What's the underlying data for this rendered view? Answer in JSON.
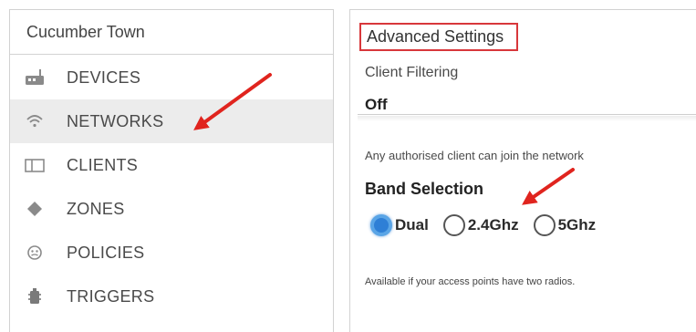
{
  "site": {
    "name": "Cucumber Town"
  },
  "nav": {
    "items": [
      {
        "label": "DEVICES",
        "icon": "device-icon"
      },
      {
        "label": "NETWORKS",
        "icon": "wifi-icon"
      },
      {
        "label": "CLIENTS",
        "icon": "clients-icon"
      },
      {
        "label": "ZONES",
        "icon": "zones-diamond-icon"
      },
      {
        "label": "POLICIES",
        "icon": "policies-icon"
      },
      {
        "label": "TRIGGERS",
        "icon": "triggers-icon"
      }
    ],
    "active": "NETWORKS"
  },
  "panel": {
    "title": "Advanced Settings",
    "client_filtering": {
      "label": "Client Filtering",
      "value": "Off",
      "description": "Any authorised client can join the network"
    },
    "band_selection": {
      "label": "Band Selection",
      "options": [
        "Dual",
        "2.4Ghz",
        "5Ghz"
      ],
      "selected": "Dual",
      "note": "Available if your access points have two radios."
    }
  },
  "colors": {
    "highlight_border": "#d8373b",
    "annotation_arrow": "#e0241e",
    "radio_selected": "#2e7fd6",
    "active_nav_bg": "#ececec"
  }
}
